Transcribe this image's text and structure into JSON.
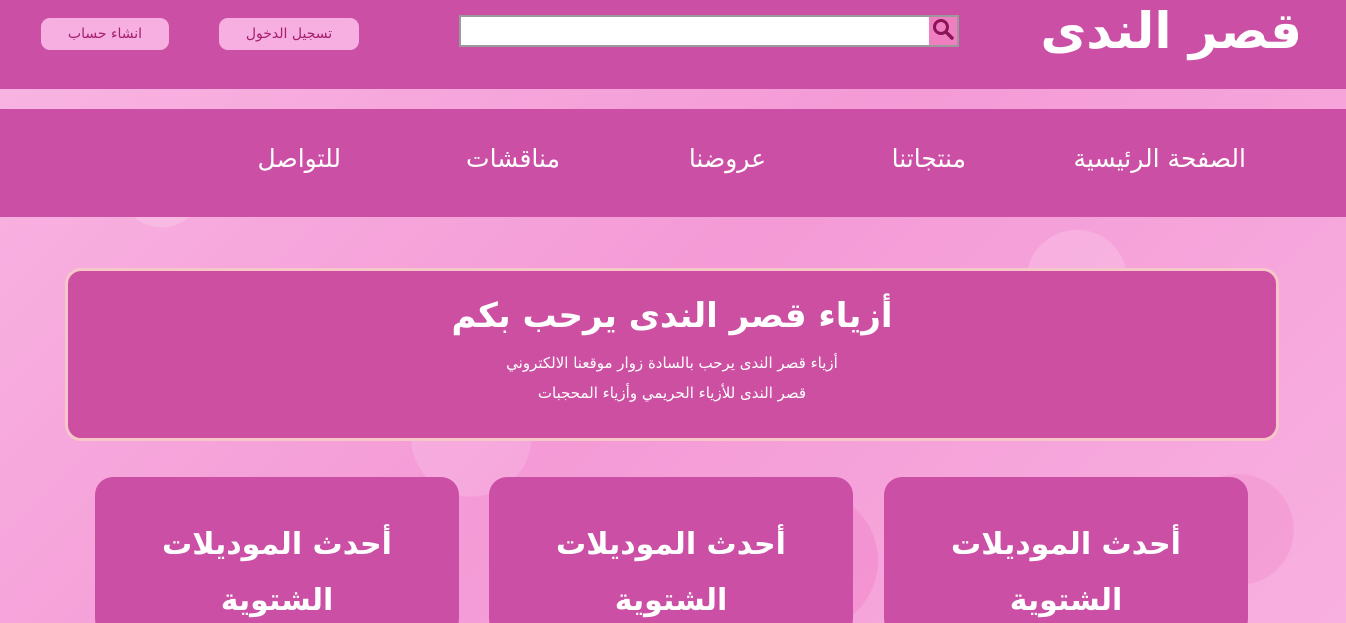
{
  "header": {
    "logo_text": "قصر الندى",
    "search": {
      "placeholder": "",
      "value": "",
      "icon": "search-icon"
    },
    "login_label": "تسجيل الدخول",
    "register_label": "انشاء حساب"
  },
  "nav": {
    "items": [
      {
        "label": "الصفحة الرئيسية"
      },
      {
        "label": "منتجاتنا"
      },
      {
        "label": "عروضنا"
      },
      {
        "label": "مناقشات"
      },
      {
        "label": "للتواصل"
      }
    ]
  },
  "welcome": {
    "title": "أزياء قصر الندى يرحب بكم",
    "line1": "أزياء قصر الندى يرحب بالسادة زوار موقعنا الالكتروني",
    "line2": "قصر الندى للأزياء الحريمي وأزياء المحجبات"
  },
  "cards": [
    {
      "title": "أحدث الموديلات الشتوية"
    },
    {
      "title": "أحدث الموديلات الشتوية"
    },
    {
      "title": "أحدث الموديلات الشتوية"
    }
  ],
  "colors": {
    "header_bg": "#cb4fa5",
    "page_bg": "#f7a8dd",
    "button_bg": "#f7aee0",
    "button_text": "#a4206f",
    "search_button_bg": "#ef7fc0",
    "welcome_border": "#f6c7c9"
  }
}
